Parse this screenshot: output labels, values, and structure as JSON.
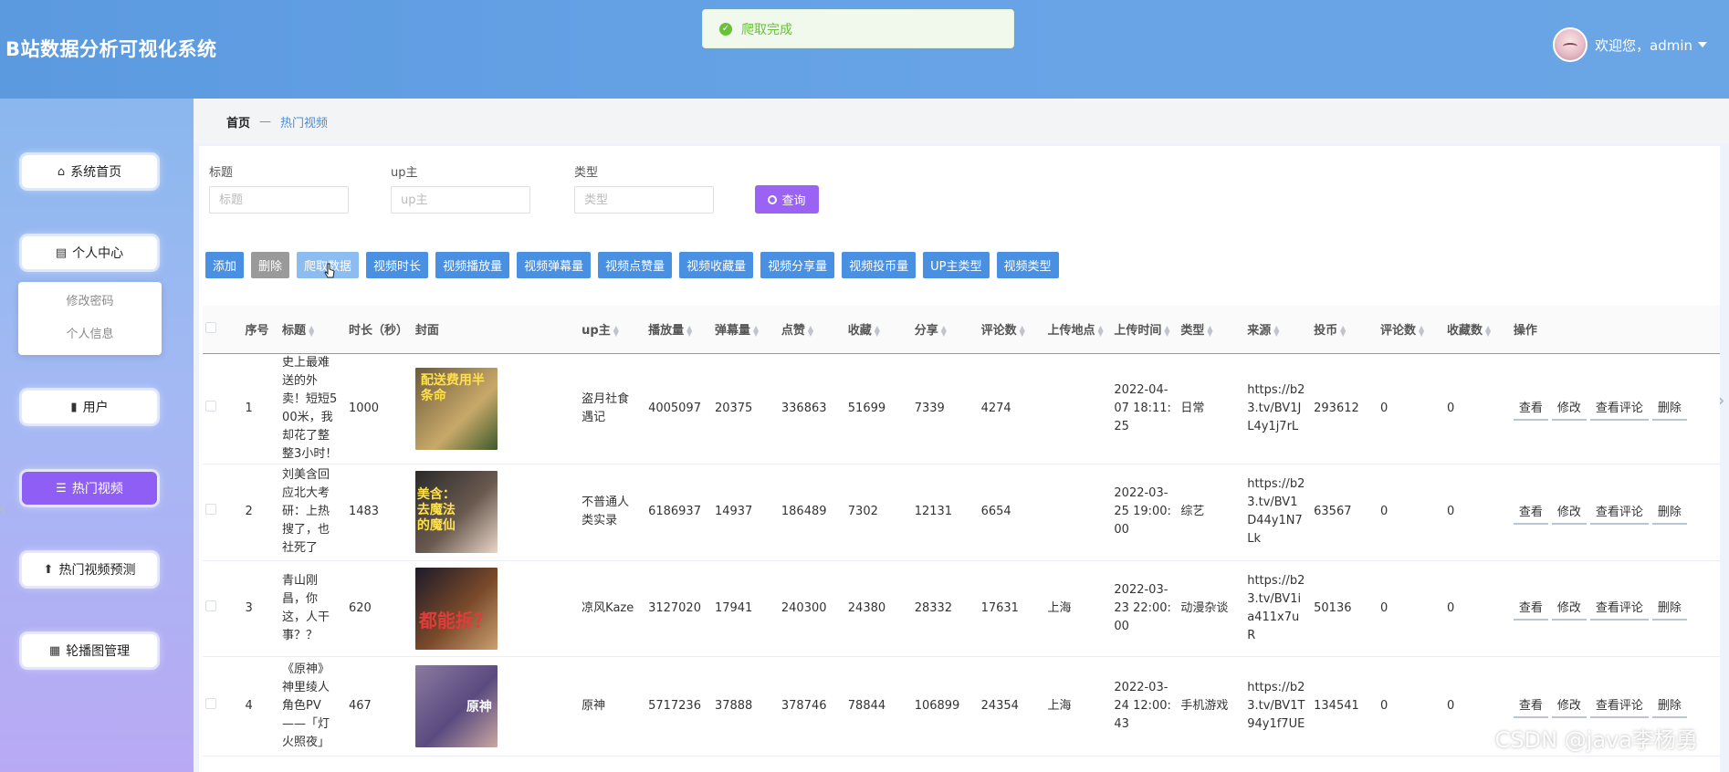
{
  "app": {
    "title": "B站数据分析可视化系统"
  },
  "user": {
    "greeting": "欢迎您，admin"
  },
  "toast": {
    "message": "爬取完成"
  },
  "sidebar": {
    "items": [
      {
        "label": "系统首页",
        "icon": "home-icon"
      },
      {
        "label": "个人中心",
        "icon": "profile-icon"
      },
      {
        "label": "用户",
        "icon": "book-icon"
      },
      {
        "label": "热门视频",
        "icon": "list-icon"
      },
      {
        "label": "热门视频预测",
        "icon": "person-icon"
      },
      {
        "label": "轮播图管理",
        "icon": "grid-icon"
      }
    ],
    "submenu": [
      "修改密码",
      "个人信息"
    ]
  },
  "breadcrumb": {
    "home": "首页",
    "current": "热门视频"
  },
  "search": {
    "title_label": "标题",
    "title_placeholder": "标题",
    "up_label": "up主",
    "up_placeholder": "up主",
    "type_label": "类型",
    "type_placeholder": "类型",
    "query_label": "查询"
  },
  "toolbar": {
    "buttons": [
      "添加",
      "删除",
      "爬取数据",
      "视频时长",
      "视频播放量",
      "视频弹幕量",
      "视频点赞量",
      "视频收藏量",
      "视频分享量",
      "视频投币量",
      "UP主类型",
      "视频类型"
    ]
  },
  "table": {
    "headers": [
      "序号",
      "标题",
      "时长（秒）",
      "封面",
      "up主",
      "播放量",
      "弹幕量",
      "点赞",
      "收藏",
      "分享",
      "评论数",
      "上传地点",
      "上传时间",
      "类型",
      "来源",
      "投币",
      "评论数",
      "收藏数",
      "操作"
    ],
    "rows": [
      {
        "idx": "1",
        "title": "史上最难送的外卖！短短500米，我却花了整整3小时！",
        "duration": "1000",
        "cover_text": "配送费用半条命",
        "up": "盗月社食遇记",
        "plays": "4005097",
        "danmaku": "20375",
        "likes": "336863",
        "fav": "51699",
        "share": "7339",
        "comments": "4274",
        "location": "",
        "time": "2022-04-07 18:11:25",
        "type": "日常",
        "source": "https://b23.tv/BV1JL4y1j7rL",
        "coins": "293612",
        "comments2": "0",
        "favs2": "0"
      },
      {
        "idx": "2",
        "title": "刘美含回应北大考研：上热搜了，也社死了",
        "duration": "1483",
        "cover_text": "美含：去魔法的魔仙",
        "up": "不普通人类实录",
        "plays": "6186937",
        "danmaku": "14937",
        "likes": "186489",
        "fav": "7302",
        "share": "12131",
        "comments": "6654",
        "location": "",
        "time": "2022-03-25 19:00:00",
        "type": "综艺",
        "source": "https://b23.tv/BV1D44y1N7Lk",
        "coins": "63567",
        "comments2": "0",
        "favs2": "0"
      },
      {
        "idx": "3",
        "title": "青山刚昌，你这，人干事？？",
        "duration": "620",
        "cover_text": "都能拆？",
        "up": "凉风Kaze",
        "plays": "3127020",
        "danmaku": "17941",
        "likes": "240300",
        "fav": "24380",
        "share": "28332",
        "comments": "17631",
        "location": "上海",
        "time": "2022-03-23 22:00:00",
        "type": "动漫杂谈",
        "source": "https://b23.tv/BV1ia411x7uR",
        "coins": "50136",
        "comments2": "0",
        "favs2": "0"
      },
      {
        "idx": "4",
        "title": "《原神》神里绫人角色PV——「灯火照夜」",
        "duration": "467",
        "cover_text": "原神",
        "up": "原神",
        "plays": "5717236",
        "danmaku": "37888",
        "likes": "378746",
        "fav": "78844",
        "share": "106899",
        "comments": "24354",
        "location": "上海",
        "time": "2022-03-24 12:00:43",
        "type": "手机游戏",
        "source": "https://b23.tv/BV1T94y1f7UE",
        "coins": "134541",
        "comments2": "0",
        "favs2": "0"
      }
    ],
    "actions": [
      "查看",
      "修改",
      "查看评论",
      "删除"
    ]
  },
  "watermark": "CSDN @java李杨勇",
  "colors": {
    "header": "#5c9ae0",
    "accent": "#9a63f4",
    "primary_btn": "#4a90e2",
    "success": "#67c23a"
  }
}
